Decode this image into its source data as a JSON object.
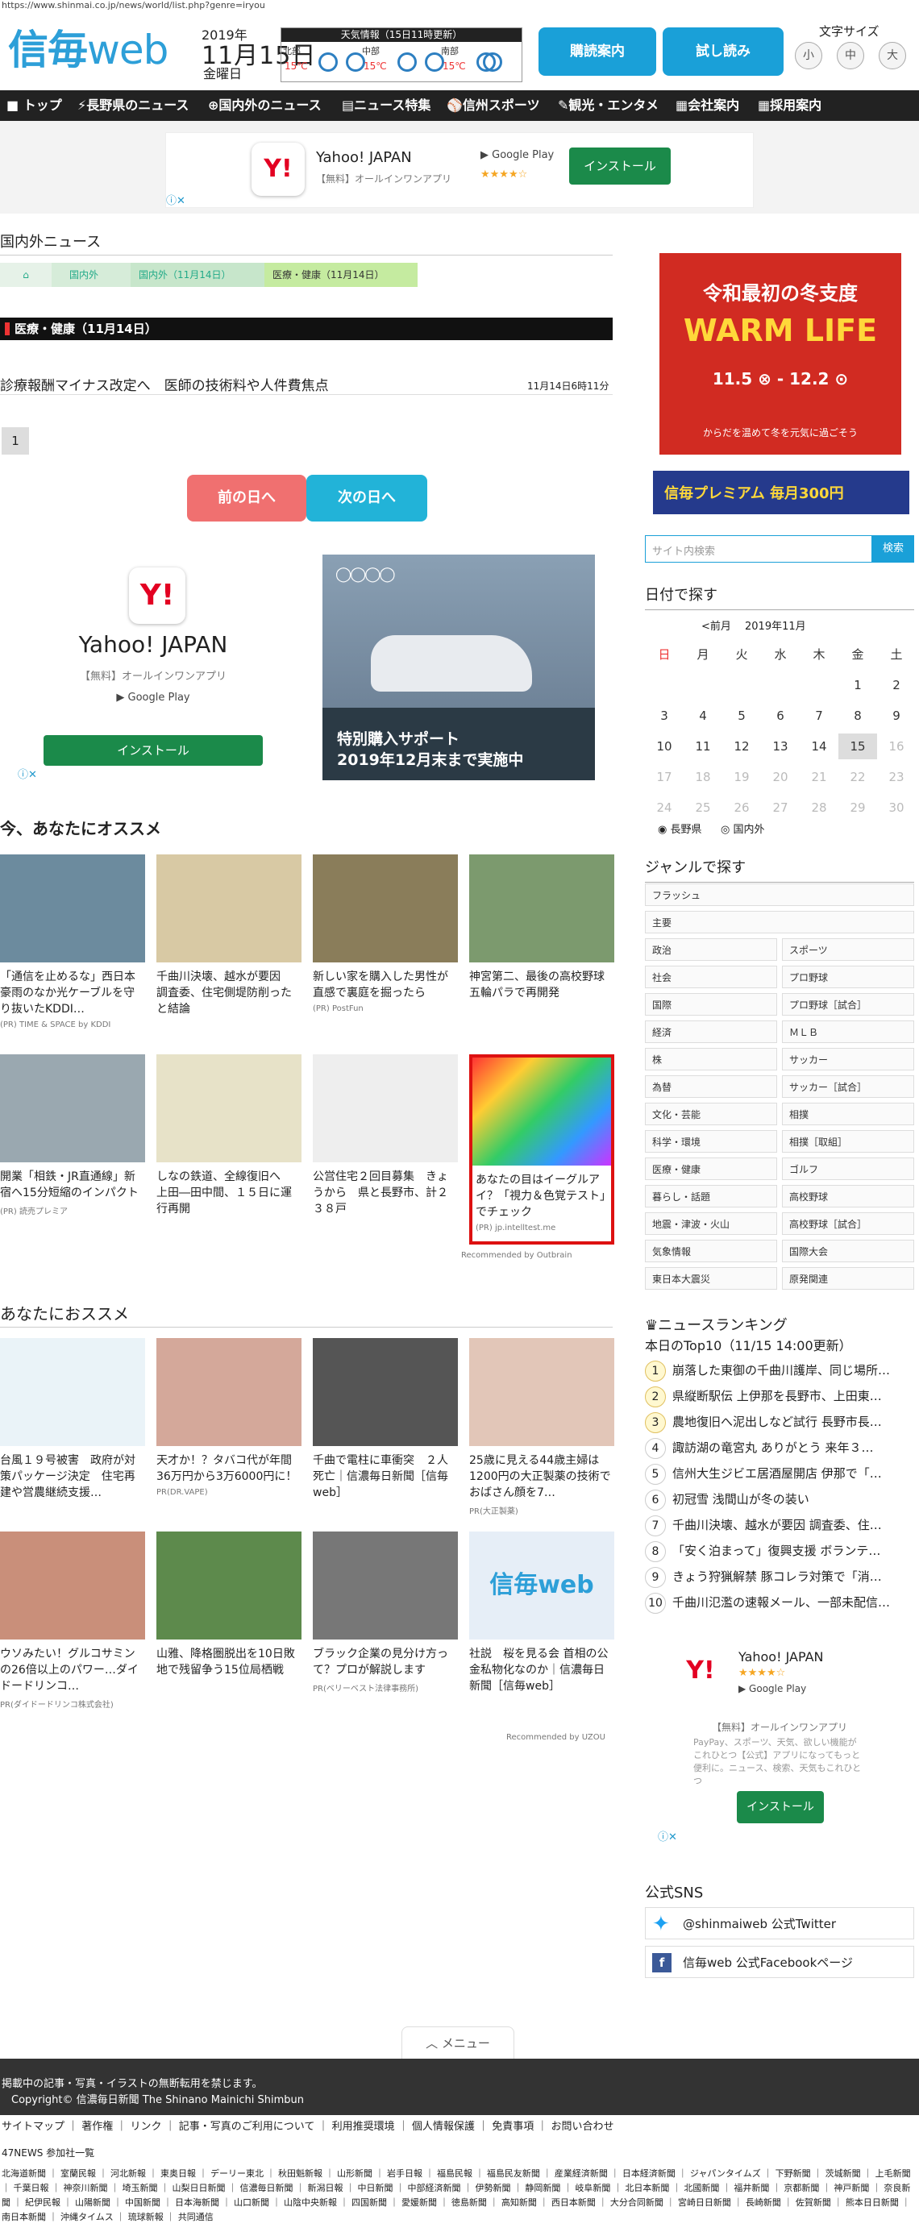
{
  "url": "https://www.shinmai.co.jp/news/world/list.php?genre=iryou",
  "logo": {
    "main": "信毎",
    "sub": "web"
  },
  "date": {
    "year": "2019年",
    "md": "11月15日",
    "weekday": "金曜日"
  },
  "weather": {
    "header": "天気情報（15日11時更新）",
    "cells": [
      {
        "area": "北部",
        "temp": "15℃"
      },
      {
        "area": "中部",
        "temp": "15℃"
      },
      {
        "area": "南部",
        "temp": "15℃"
      }
    ]
  },
  "header_buttons": {
    "subscribe": "購読案内",
    "trial": "試し読み"
  },
  "font_size": {
    "label": "文字サイズ",
    "small": "小",
    "medium": "中",
    "large": "大"
  },
  "nav": [
    "トップ",
    "長野県のニュース",
    "国内外のニュース",
    "ニュース特集",
    "信州スポーツ",
    "観光・エンタメ",
    "会社案内",
    "採用案内"
  ],
  "top_ad": {
    "brand": "Yahoo! JAPAN",
    "note": "【無料】オールインワンアプリ",
    "stars": "★★★★☆",
    "store": "Google Play",
    "install": "インストール"
  },
  "page": {
    "section": "国内外ニュース",
    "crumbs": [
      "国内外",
      "国内外（11月14日）",
      "医療・健康（11月14日）"
    ],
    "category": "医療・健康（11月14日）",
    "article": {
      "title": "診療報酬マイナス改定へ　医師の技術料や人件費焦点",
      "time": "11月14日6時11分"
    },
    "page_num": "1",
    "prev": "前の日へ",
    "next": "次の日へ"
  },
  "ad_yahoo": {
    "brand": "Yahoo! JAPAN",
    "note": "【無料】オールインワンアプリ",
    "store": "Google Play",
    "install": "インストール"
  },
  "ad_car": {
    "line1": "特別購入サポート",
    "line2": "2019年12月末まで実施中"
  },
  "recommend1": {
    "title": "今、あなたにオススメ",
    "credit": "Recommended by Outbrain",
    "cards": [
      {
        "t": "「通信を止めるな」西日本豪雨のなか光ケーブルを守り抜いたKDDI…",
        "pr": "(PR) TIME & SPACE by KDDI"
      },
      {
        "t": "千曲川決壊、越水が要因　調査委、住宅側堤防削ったと結論",
        "pr": ""
      },
      {
        "t": "新しい家を購入した男性が直感で裏庭を掘ったら",
        "pr": "(PR) PostFun"
      },
      {
        "t": "神宮第二、最後の高校野球　五輪パラで再開発",
        "pr": ""
      },
      {
        "t": "開業「相鉄・JR直通線」新宿へ15分短縮のインパクト",
        "pr": "(PR) 読売プレミア"
      },
      {
        "t": "しなの鉄道、全線復旧へ　上田―田中間、１５日に運行再開",
        "pr": ""
      },
      {
        "t": "公営住宅２回目募集　きょうから　県と長野市、計２３８戸",
        "pr": ""
      },
      {
        "t": "あなたの目はイーグルアイ？「視力＆色覚テスト」でチェック",
        "pr": "(PR) jp.intelltest.me"
      }
    ]
  },
  "recommend2": {
    "title": "あなたにおススメ",
    "credit": "Recommended by UZOU",
    "cards": [
      {
        "t": "台風１９号被害　政府が対策パッケージ決定　住宅再建や営農継続支援…",
        "pr": ""
      },
      {
        "t": "天才か！？タバコ代が年間36万円から3万6000円に！",
        "pr": "PR(DR.VAPE)"
      },
      {
        "t": "千曲で電柱に車衝突　２人死亡｜信濃毎日新聞［信毎web］",
        "pr": ""
      },
      {
        "t": "25歳に見える44歳主婦は1200円の大正製薬の技術でおばさん顔を7…",
        "pr": "PR(大正製薬)"
      },
      {
        "t": "ウソみたい！グルコサミンの26倍以上のパワー…ダイドードリンコ…",
        "pr": "PR(ダイドードリンコ株式会社)"
      },
      {
        "t": "山雅、降格圏脱出を10日敗地で残留争う15位局栖戦",
        "pr": ""
      },
      {
        "t": "ブラック企業の見分け方って？プロが解説します",
        "pr": "PR(ベリーベスト法律事務所)"
      },
      {
        "t": "社説　桜を見る会 首相の公金私物化なのか｜信濃毎日新聞［信毎web］",
        "pr": ""
      }
    ]
  },
  "side_ad": {
    "top": "令和最初の冬支度",
    "main": "WARM LIFE",
    "dates": "11.5 ⊗ ‐ 12.2 ⊙",
    "bottom": "からだを温めて冬を元気に過ごそう"
  },
  "side_banner": {
    "text": "信毎プレミアム 毎月300円"
  },
  "search": {
    "placeholder": "サイト内検索",
    "button": "検索"
  },
  "calendar": {
    "title": "日付で探す",
    "prev": "<前月",
    "month": "2019年11月",
    "days": [
      "日",
      "月",
      "火",
      "水",
      "木",
      "金",
      "土"
    ],
    "rows": [
      [
        "",
        "",
        "",
        "",
        "",
        "1",
        "2"
      ],
      [
        "3",
        "4",
        "5",
        "6",
        "7",
        "8",
        "9"
      ],
      [
        "10",
        "11",
        "12",
        "13",
        "14",
        "15",
        "16"
      ],
      [
        "17",
        "18",
        "19",
        "20",
        "21",
        "22",
        "23"
      ],
      [
        "24",
        "25",
        "26",
        "27",
        "28",
        "29",
        "30"
      ]
    ],
    "opt1": "長野県",
    "opt2": "国内外"
  },
  "genre": {
    "title": "ジャンルで探す",
    "wide": [
      "フラッシュ",
      "主要"
    ],
    "pairs": [
      [
        "政治",
        "スポーツ"
      ],
      [
        "社会",
        "プロ野球"
      ],
      [
        "国際",
        "プロ野球［試合］"
      ],
      [
        "経済",
        "ＭＬＢ"
      ],
      [
        "株",
        "サッカー"
      ],
      [
        "為替",
        "サッカー［試合］"
      ],
      [
        "文化・芸能",
        "相撲"
      ],
      [
        "科学・環境",
        "相撲［取組］"
      ],
      [
        "医療・健康",
        "ゴルフ"
      ],
      [
        "暮らし・話題",
        "高校野球"
      ],
      [
        "地震・津波・火山",
        "高校野球［試合］"
      ],
      [
        "気象情報",
        "国際大会"
      ],
      [
        "東日本大震災",
        "原発関連"
      ]
    ]
  },
  "ranking": {
    "title": "ニュースランキング",
    "subtitle": "本日のTop10（11/15 14:00更新）",
    "items": [
      "崩落した東御の千曲川護岸、同じ場所…",
      "県縦断駅伝 上伊那を長野市、上田東…",
      "農地復旧へ泥出しなど試行 長野市長…",
      "諏訪湖の竜宮丸 ありがとう 来年３…",
      "信州大生ジビエ居酒屋開店 伊那で「…",
      "初冠雪 浅間山が冬の装い",
      "千曲川決壊、越水が要因 調査委、住…",
      "「安く泊まって」復興支援 ボランテ…",
      "きょう狩猟解禁 豚コレラ対策で「消…",
      "千曲川氾濫の速報メール、一部未配信…"
    ]
  },
  "side_yahoo": {
    "brand": "Yahoo! JAPAN",
    "stars": "★★★★☆",
    "store": "Google Play",
    "note": "【無料】オールインワンアプリ",
    "desc": "PayPay、スポーツ、天気、欲しい機能がこれひとつ【公式】アプリになってもっと便利に。ニュース、検索、天気もこれひとつ",
    "install": "インストール"
  },
  "sns": {
    "title": "公式SNS",
    "twitter": "@shinmaiweb 公式Twitter",
    "facebook": "信毎web 公式Facebookページ"
  },
  "menu": "メニュー",
  "footer": {
    "notice": "掲載中の記事・写真・イラストの無断転用を禁じます。",
    "copyright": "Copyright© 信濃毎日新聞 The Shinano Mainichi Shimbun",
    "links": "サイトマップ ｜ 著作権 ｜ リンク ｜ 記事・写真のご利用について ｜ 利用推奨環境 ｜ 個人情報保護 ｜ 免責事項 ｜ お問い合わせ",
    "np_title": "47NEWS 参加社一覧",
    "np_list": "北海道新聞 ｜ 室蘭民報 ｜ 河北新報 ｜ 東奥日報 ｜ デーリー東北 ｜ 秋田魁新報 ｜ 山形新聞 ｜ 岩手日報 ｜ 福島民報 ｜ 福島民友新聞 ｜ 産業経済新聞 ｜ 日本経済新聞 ｜ ジャパンタイムズ ｜ 下野新聞 ｜ 茨城新聞 ｜ 上毛新聞 ｜ 千葉日報 ｜ 神奈川新聞 ｜ 埼玉新聞 ｜ 山梨日日新聞 ｜ 信濃毎日新聞 ｜ 新潟日報 ｜ 中日新聞 ｜ 中部経済新聞 ｜ 伊勢新聞 ｜ 静岡新聞 ｜ 岐阜新聞 ｜ 北日本新聞 ｜ 北國新聞 ｜ 福井新聞 ｜ 京都新聞 ｜ 神戸新聞 ｜ 奈良新聞 ｜ 紀伊民報 ｜ 山陽新聞 ｜ 中国新聞 ｜ 日本海新聞 ｜ 山口新聞 ｜ 山陰中央新報 ｜ 四国新聞 ｜ 愛媛新聞 ｜ 徳島新聞 ｜ 高知新聞 ｜ 西日本新聞 ｜ 大分合同新聞 ｜ 宮崎日日新聞 ｜ 長崎新聞 ｜ 佐賀新聞 ｜ 熊本日日新聞 ｜ 南日本新聞 ｜ 沖縄タイムス ｜ 琉球新報 ｜ 共同通信"
  }
}
